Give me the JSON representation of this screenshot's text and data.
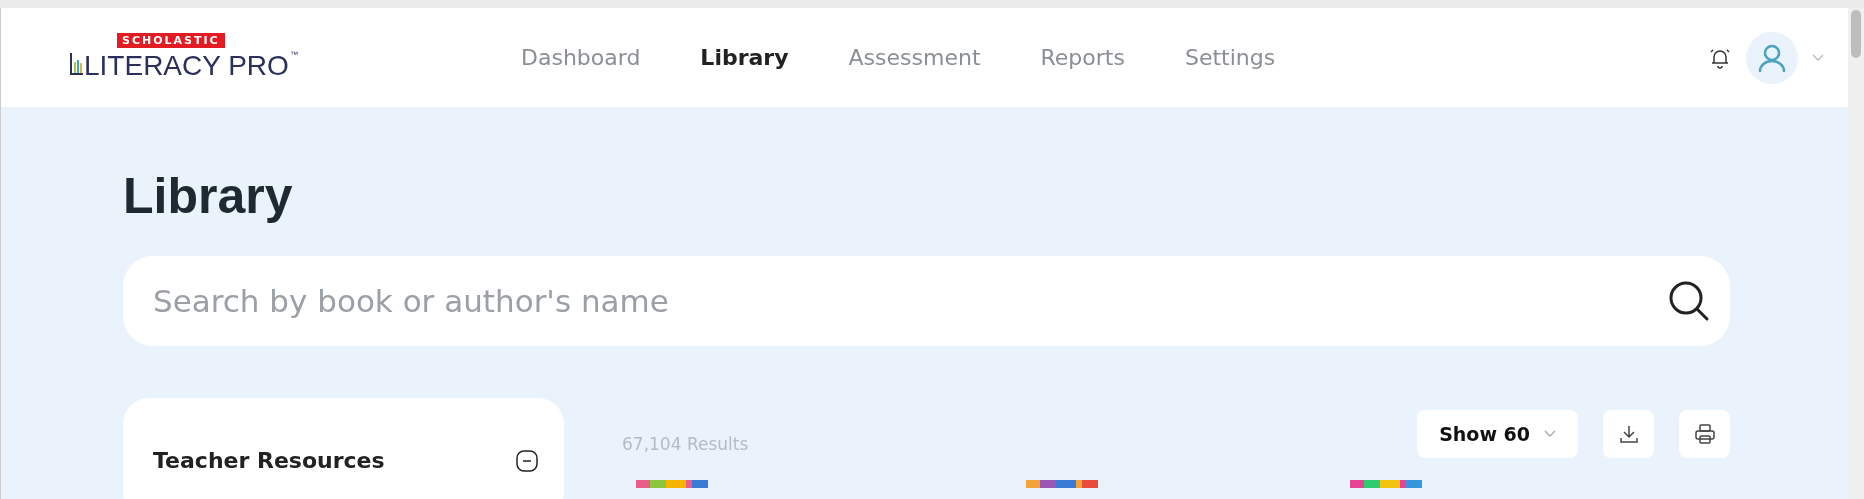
{
  "logo": {
    "brand": "SCHOLASTIC",
    "product": "LITERACY PRO",
    "mark": "™"
  },
  "nav": [
    {
      "label": "Dashboard",
      "selected": false
    },
    {
      "label": "Library",
      "selected": true
    },
    {
      "label": "Assessment",
      "selected": false
    },
    {
      "label": "Reports",
      "selected": false
    },
    {
      "label": "Settings",
      "selected": false
    }
  ],
  "page_title": "Library",
  "search": {
    "placeholder": "Search by book or author's name"
  },
  "sidebar": {
    "title": "Teacher Resources",
    "expanded": true
  },
  "results": {
    "count": "67,104 Results",
    "show": "Show 60"
  }
}
